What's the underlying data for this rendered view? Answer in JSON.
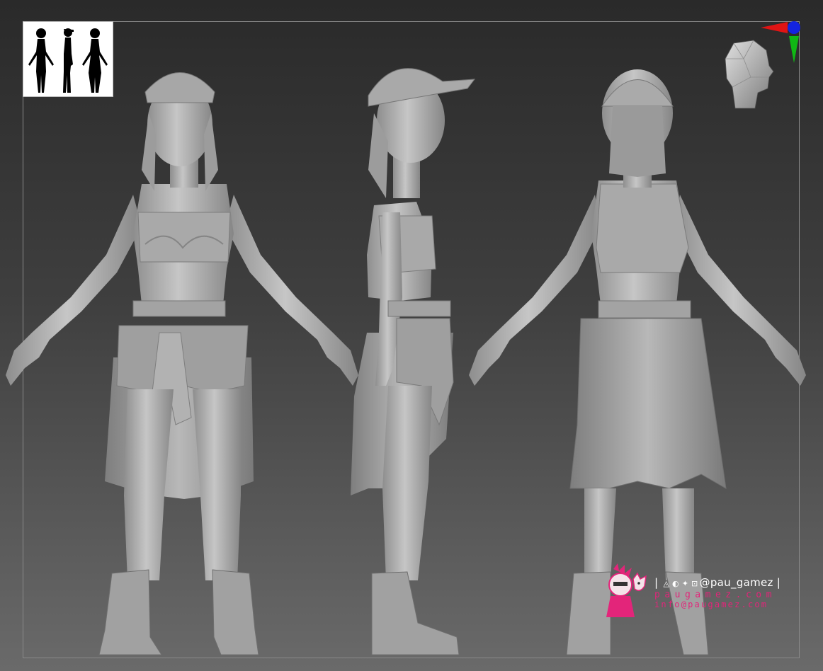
{
  "scene": {
    "views": [
      "front",
      "side",
      "back"
    ],
    "background_colors": [
      "#2a2a2a",
      "#6a6a6a"
    ],
    "mesh_color": "#b3b3b3"
  },
  "thumbnail": {
    "icon": "character-silhouettes-icon"
  },
  "gizmo": {
    "icon": "axis-gizmo-icon",
    "colors": {
      "x": "#e01414",
      "y": "#10b814",
      "z": "#1424e0"
    }
  },
  "view_cube": {
    "icon": "head-orientation-icon"
  },
  "watermark": {
    "sep_left": "|",
    "social_icons": "◬ ◐ ✦ ⊡",
    "handle": "@pau_gamez",
    "sep_right": "|",
    "site": "paugamez.com",
    "email": "info@paugamez.com",
    "accent": "#e3257a"
  }
}
